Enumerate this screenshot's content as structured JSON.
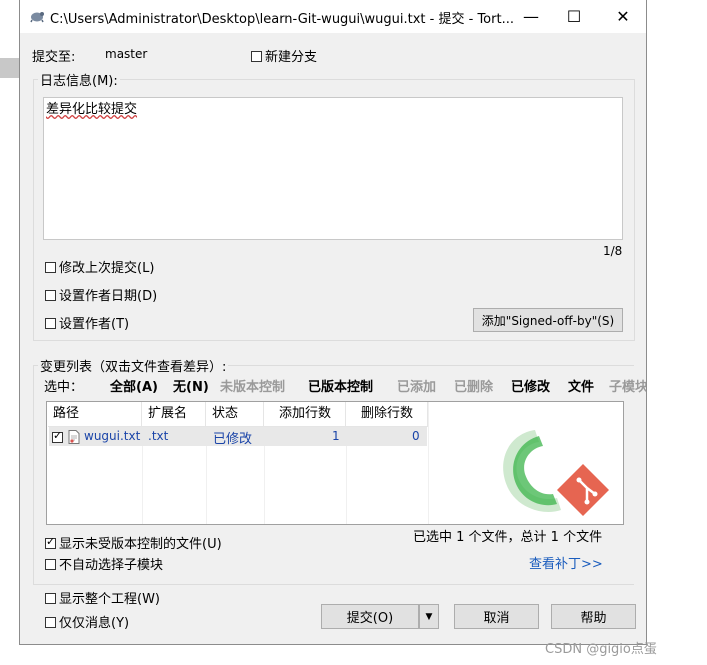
{
  "window": {
    "title": "C:\\Users\\Administrator\\Desktop\\learn-Git-wugui\\wugui.txt - 提交 - Tort...",
    "minimize": "—",
    "maximize": "☐",
    "close": "✕"
  },
  "commit_to": {
    "label": "提交至:",
    "branch": "master",
    "new_branch": "新建分支"
  },
  "log": {
    "legend": "日志信息(M):",
    "message": "差异化比较提交",
    "counter": "1/8",
    "options": [
      "修改上次提交(L)",
      "设置作者日期(D)",
      "设置作者(T)"
    ],
    "signed_off_button": "添加\"Signed-off-by\"(S)"
  },
  "changes": {
    "legend": "变更列表（双击文件查看差异）:",
    "select_label": "选中：",
    "filters": [
      {
        "label": "全部(A)",
        "disabled": false
      },
      {
        "label": "无(N)",
        "disabled": false
      },
      {
        "label": "未版本控制",
        "disabled": true
      },
      {
        "label": "已版本控制",
        "disabled": false
      },
      {
        "label": "已添加",
        "disabled": true
      },
      {
        "label": "已删除",
        "disabled": true
      },
      {
        "label": "已修改",
        "disabled": false
      },
      {
        "label": "文件",
        "disabled": false
      },
      {
        "label": "子模块",
        "disabled": true
      }
    ],
    "columns": [
      "路径",
      "扩展名",
      "状态",
      "添加行数",
      "删除行数"
    ],
    "rows": [
      {
        "path": "wugui.txt",
        "ext": ".txt",
        "status": "已修改",
        "added": "1",
        "deleted": "0",
        "checked": true
      }
    ],
    "show_unversioned": "显示未受版本控制的文件(U)",
    "no_auto_submodule": "不自动选择子模块",
    "summary": "已选中 1 个文件，总计 1 个文件",
    "view_patch": "查看补丁>>"
  },
  "bottom": {
    "show_project": "显示整个工程(W)",
    "message_only": "仅仅消息(Y)",
    "commit_button": "提交(O)",
    "dropdown_arrow": "▼",
    "cancel_button": "取消",
    "help_button": "帮助"
  },
  "watermark": "CSDN @gigio点蛋",
  "colors": {
    "link": "#1a5cbd",
    "logo_green": "#3cb44b",
    "git_red": "#e24a33"
  }
}
